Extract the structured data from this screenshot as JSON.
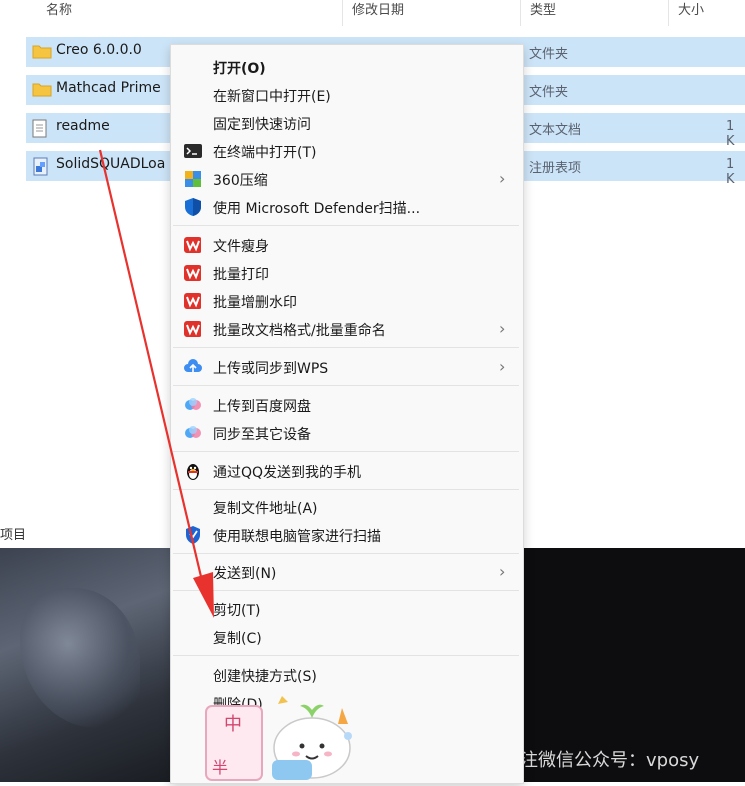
{
  "columns": {
    "name": "名称",
    "modified": "修改日期",
    "type": "类型",
    "size": "大小"
  },
  "files": [
    {
      "name": "Creo 6.0.0.0",
      "type": "文件夹",
      "size": "",
      "icon": "folder-icon"
    },
    {
      "name": "Mathcad Prime",
      "type": "文件夹",
      "size": "",
      "icon": "folder-icon"
    },
    {
      "name": "readme",
      "type": "文本文档",
      "size": "1 K",
      "icon": "text-file-icon"
    },
    {
      "name": "SolidSQUADLoa",
      "type": "注册表项",
      "size": "1 K",
      "icon": "registry-file-icon"
    }
  ],
  "status_bar": "项目",
  "context_menu": {
    "items": [
      {
        "label": "打开(O)"
      },
      {
        "label": "在新窗口中打开(E)"
      },
      {
        "label": "固定到快速访问"
      },
      {
        "label": "在终端中打开(T)"
      },
      {
        "label": "360压缩"
      },
      {
        "label": "使用 Microsoft Defender扫描..."
      },
      {
        "label": "文件瘦身"
      },
      {
        "label": "批量打印"
      },
      {
        "label": "批量增删水印"
      },
      {
        "label": "批量改文档格式/批量重命名"
      },
      {
        "label": "上传或同步到WPS"
      },
      {
        "label": "上传到百度网盘"
      },
      {
        "label": "同步至其它设备"
      },
      {
        "label": "通过QQ发送到我的手机"
      },
      {
        "label": "复制文件地址(A)"
      },
      {
        "label": "使用联想电脑管家进行扫描"
      },
      {
        "label": "发送到(N)"
      },
      {
        "label": "剪切(T)"
      },
      {
        "label": "复制(C)"
      },
      {
        "label": "创建快捷方式(S)"
      },
      {
        "label": "删除(D)"
      }
    ]
  },
  "watermark": "下载链接关注微信公众号：vposy",
  "sticker": {
    "char1": "中",
    "char2": "半"
  },
  "colors": {
    "selection": "#cce4f7",
    "menu_bg": "#f9f9f9",
    "wps_red": "#e0312b",
    "annotation_arrow": "#e8322e"
  }
}
